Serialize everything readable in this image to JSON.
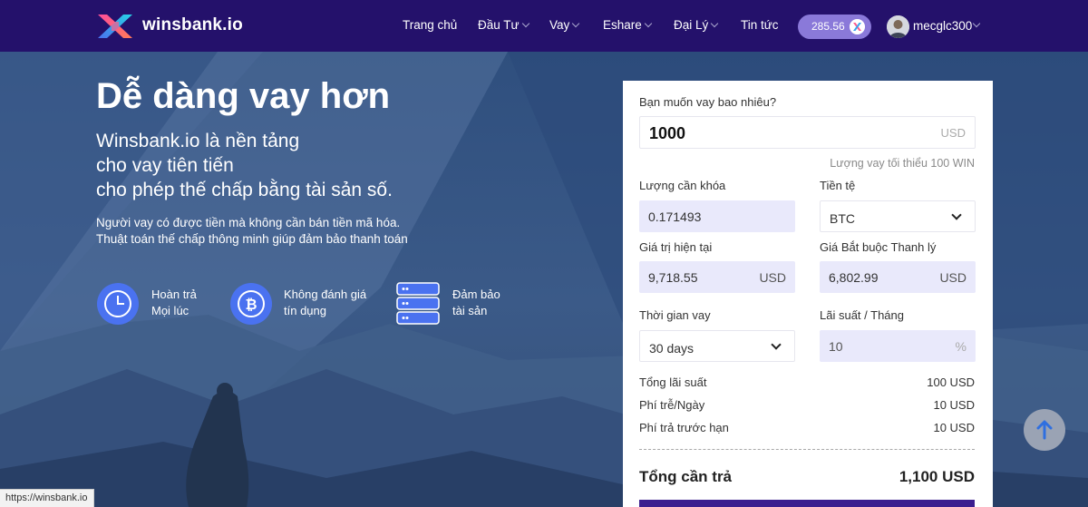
{
  "brand": {
    "name": "winsbank.io"
  },
  "nav": {
    "items": [
      {
        "label": "Trang chủ",
        "dropdown": false
      },
      {
        "label": "Đầu Tư",
        "dropdown": true
      },
      {
        "label": "Vay",
        "dropdown": true
      },
      {
        "label": "Eshare",
        "dropdown": true
      },
      {
        "label": "Đại Lý",
        "dropdown": true
      },
      {
        "label": "Tin tức",
        "dropdown": false
      }
    ],
    "balance": "285.56",
    "username": "mecglc300"
  },
  "hero": {
    "title": "Dễ dàng vay hơn",
    "subtitle_lines": [
      "Winsbank.io là nền tảng",
      "cho vay tiên tiến",
      "cho phép thế chấp bằng tài sản số."
    ],
    "desc_lines": [
      "Người vay có được tiền mà không cần bán tiền mã hóa.",
      "Thuật toán thế chấp thông minh giúp đảm bảo thanh toán"
    ],
    "features": [
      {
        "icon": "clock-icon",
        "line1": "Hoàn trả",
        "line2": "Mọi lúc"
      },
      {
        "icon": "bitcoin-icon",
        "line1": "Không đánh giá",
        "line2": "tín dụng"
      },
      {
        "icon": "server-icon",
        "line1": "Đảm bảo",
        "line2": "tài sản"
      }
    ]
  },
  "form": {
    "amount_label": "Bạn muốn vay bao nhiêu?",
    "amount_value": "1000",
    "amount_unit": "USD",
    "min_note": "Lượng vay tối thiểu 100 WIN",
    "lock_label": "Lượng cần khóa",
    "lock_value": "0.171493",
    "currency_label": "Tiền tệ",
    "currency_value": "BTC",
    "current_value_label": "Giá trị hiện tại",
    "current_value": "9,718.55",
    "current_unit": "USD",
    "liquidation_label": "Giá Bắt buộc Thanh lý",
    "liquidation_value": "6,802.99",
    "liquidation_unit": "USD",
    "term_label": "Thời gian vay",
    "term_value": "30 days",
    "rate_label": "Lãi suất / Tháng",
    "rate_value": "10",
    "rate_unit": "%",
    "summary": [
      {
        "label": "Tổng lãi suất",
        "value": "100 USD"
      },
      {
        "label": "Phí trễ/Ngày",
        "value": "10 USD"
      },
      {
        "label": "Phí trả trước hạn",
        "value": "10 USD"
      }
    ],
    "total_label": "Tổng cần trả",
    "total_value": "1,100 USD"
  },
  "status_bar": {
    "url": "https://winsbank.io"
  },
  "colors": {
    "navbar": "#24116b",
    "accent": "#3b1e8f",
    "pill": "#8a79d9",
    "field_tint": "#e9e9fb",
    "icon_blue": "#4a72f0"
  }
}
